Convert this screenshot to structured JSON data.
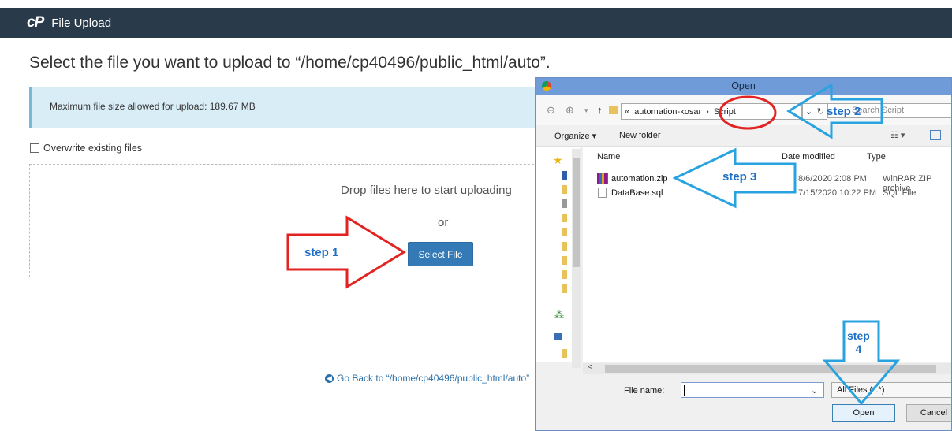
{
  "header": {
    "logo": "cP",
    "title": "File Upload"
  },
  "page": {
    "heading": "Select the file you want to upload to “/home/cp40496/public_html/auto”.",
    "max_size": "Maximum file size allowed for upload: 189.67 MB",
    "overwrite_label": "Overwrite existing files",
    "drop_text": "Drop files here to start uploading",
    "or_text": "or",
    "select_button": "Select File",
    "go_back": "Go Back to “/home/cp40496/public_html/auto”"
  },
  "annotations": {
    "step1": "step 1",
    "step2": "step 2",
    "step3": "step 3",
    "step4_line1": "step",
    "step4_line2": "4",
    "colors": {
      "red": "#e32222",
      "blue": "#29a3e0"
    }
  },
  "dialog": {
    "title": "Open",
    "breadcrumb": {
      "prefix": "«",
      "parent": "automation-kosar",
      "current": "Script"
    },
    "search_placeholder": "Search Script",
    "organize": "Organize ▾",
    "new_folder": "New folder",
    "columns": {
      "name": "Name",
      "date": "Date modified",
      "type": "Type"
    },
    "files": [
      {
        "name": "automation.zip",
        "date": "8/6/2020 2:08 PM",
        "type": "WinRAR ZIP archive"
      },
      {
        "name": "DataBase.sql",
        "date": "7/15/2020 10:22 PM",
        "type": "SQL File"
      }
    ],
    "file_name_label": "File name:",
    "file_name_value": "",
    "filter": "All Files (*.*)",
    "open_button": "Open",
    "cancel_button": "Cancel"
  }
}
